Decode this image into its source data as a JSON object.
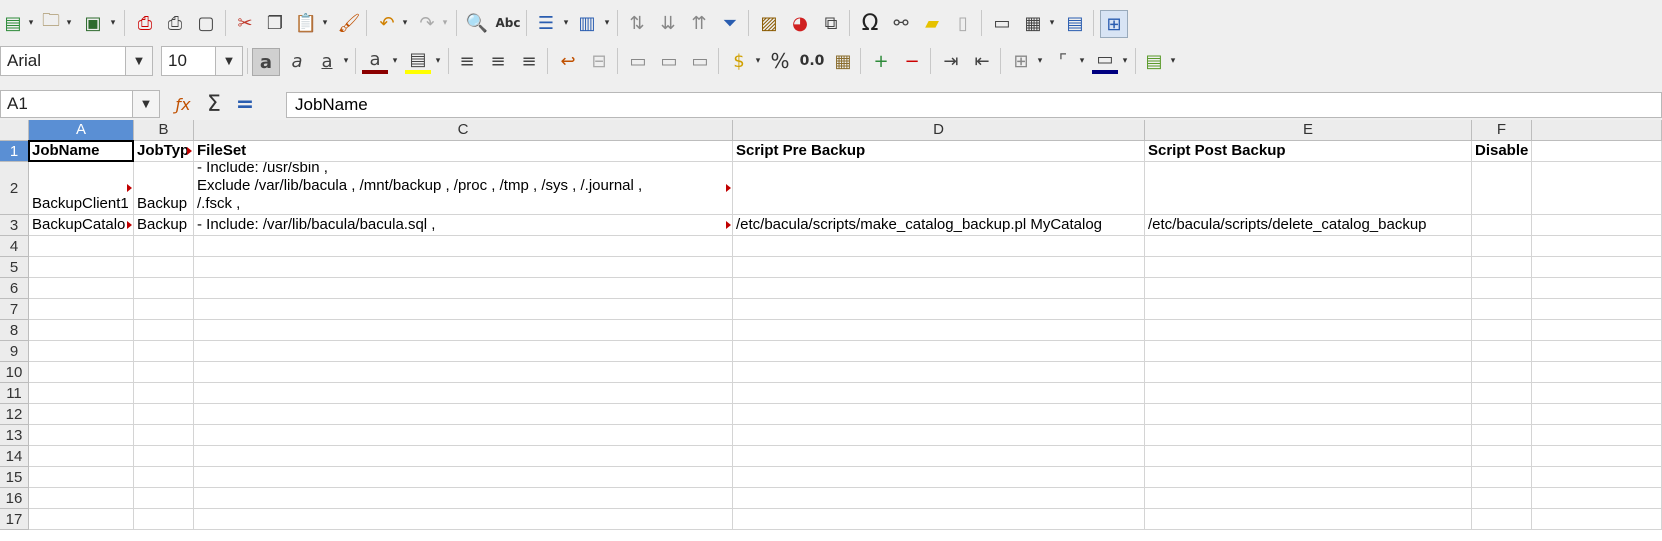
{
  "toolbar1": {
    "icons": [
      "new-icon",
      "open-icon",
      "save-icon",
      "export-pdf-icon",
      "print-icon",
      "print-preview-icon",
      "cut-icon",
      "copy-icon",
      "paste-icon",
      "clone-formatting-icon",
      "undo-icon",
      "redo-icon",
      "find-replace-icon",
      "spelling-icon",
      "row-icon",
      "column-icon",
      "sort-icon",
      "sort-ascending-icon",
      "sort-descending-icon",
      "autofilter-icon",
      "image-icon",
      "chart-icon",
      "pivot-table-icon",
      "special-character-icon",
      "hyperlink-icon",
      "comment-icon",
      "header-footer-icon",
      "define-print-area-icon",
      "freeze-rows-columns-icon",
      "split-window-icon",
      "show-draw-functions-icon"
    ],
    "spelling_label": "Abc"
  },
  "toolbar2": {
    "font_name": "Arial",
    "font_size": "10",
    "percent_label": "%",
    "number_label": "0.0",
    "colors": {
      "font_color": "#8b0000",
      "highlight": "#ffff00",
      "border_color": "#000080"
    }
  },
  "name_box": "A1",
  "formula": "JobName",
  "columns": [
    {
      "id": "A",
      "selected": true
    },
    {
      "id": "B",
      "selected": false
    },
    {
      "id": "C",
      "selected": false
    },
    {
      "id": "D",
      "selected": false
    },
    {
      "id": "E",
      "selected": false
    },
    {
      "id": "F",
      "selected": false
    }
  ],
  "rows": [
    "1",
    "2",
    "3",
    "4",
    "5",
    "6",
    "7",
    "8",
    "9",
    "10",
    "11",
    "12",
    "13",
    "14",
    "15",
    "16",
    "17"
  ],
  "cells": {
    "A1": "JobName",
    "B1": "JobTyp",
    "C1": "FileSet",
    "D1": "Script Pre Backup",
    "E1": "Script Post Backup",
    "F1": "Disable",
    "A2": "BackupClient1",
    "B2": "Backup",
    "C2": "- Include: /usr/sbin ,\nExclude /var/lib/bacula , /mnt/backup , /proc , /tmp , /sys , /.journal ,\n/.fsck ,",
    "A3": "BackupCatalo",
    "B3": "Backup",
    "C3": "- Include: /var/lib/bacula/bacula.sql ,",
    "D3": "/etc/bacula/scripts/make_catalog_backup.pl MyCatalog",
    "E3": "/etc/bacula/scripts/delete_catalog_backup"
  }
}
